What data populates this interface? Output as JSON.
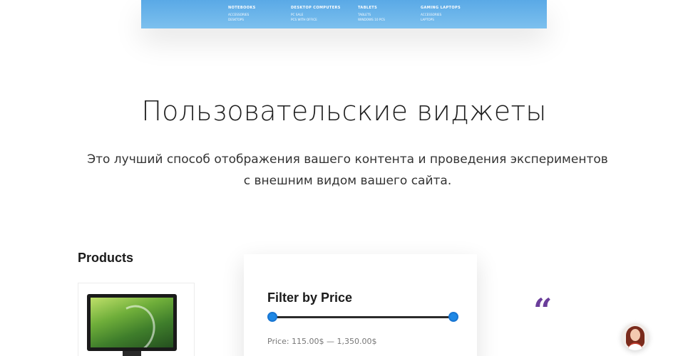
{
  "menu_preview": {
    "columns": [
      {
        "heading": "NOTEBOOKS",
        "items": [
          "ACCESSORIES",
          "DESKTOPS"
        ]
      },
      {
        "heading": "DESKTOP COMPUTERS",
        "items": [
          "PC SALE",
          "PCS WITH OFFICE"
        ]
      },
      {
        "heading": "TABLETS",
        "items": [
          "TABLETS",
          "WINDOWS 10 PCS"
        ]
      },
      {
        "heading": "GAMING LAPTOPS",
        "items": [
          "ACCESSORIES",
          "LAPTOPS"
        ]
      }
    ]
  },
  "section": {
    "title": "Пользовательские виджеты",
    "subtitle_line1": "Это лучший способ отображения вашего контента и проведения экспериментов",
    "subtitle_line2": "с внешним видом вашего сайта."
  },
  "products_widget": {
    "title": "Products"
  },
  "price_filter": {
    "title": "Filter by Price",
    "range_text": "Price: 115.00$ — 1,350.00$",
    "min_fraction": 0,
    "max_fraction": 1,
    "accent_color": "#1e88e5"
  },
  "testimonial": {
    "quote_glyph": "“",
    "accent_color": "#6a3d9a"
  }
}
